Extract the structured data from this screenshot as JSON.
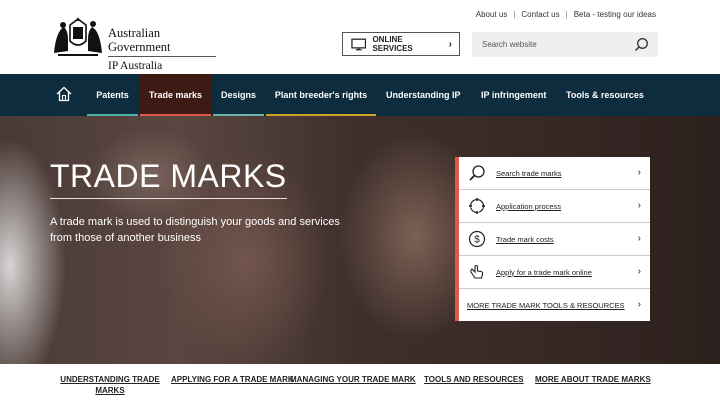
{
  "header": {
    "logo": {
      "line1": "Australian Government",
      "line2": "IP Australia"
    },
    "top_links": [
      "About us",
      "Contact us",
      "Beta - testing our ideas"
    ],
    "online_services": "ONLINE SERVICES",
    "search_placeholder": "Search website"
  },
  "nav": {
    "items": [
      {
        "label": "Patents",
        "bar_color": "#4fb3a7"
      },
      {
        "label": "Trade marks",
        "bar_color": "#e1584a",
        "active": true
      },
      {
        "label": "Designs",
        "bar_color": "#6cb6a9"
      },
      {
        "label": "Plant breeder's rights",
        "bar_color": "#c9a227"
      },
      {
        "label": "Understanding IP",
        "bar_color": ""
      },
      {
        "label": "IP infringement",
        "bar_color": ""
      },
      {
        "label": "Tools & resources",
        "bar_color": ""
      }
    ]
  },
  "hero": {
    "title": "TRADE MARKS",
    "subtitle": "A trade mark is used to distinguish your goods and services from those of another business"
  },
  "quick_links": [
    {
      "label": "Search trade marks",
      "icon": "magnifier-icon"
    },
    {
      "label": "Application process",
      "icon": "cycle-icon"
    },
    {
      "label": "Trade mark costs",
      "icon": "dollar-icon"
    },
    {
      "label": "Apply for a trade mark online",
      "icon": "pointer-hand-icon"
    },
    {
      "label": "MORE TRADE MARK TOOLS & RESOURCES",
      "icon": ""
    }
  ],
  "bottom_links": [
    "UNDERSTANDING TRADE MARKS",
    "APPLYING FOR A TRADE MARK",
    "MANAGING YOUR TRADE MARK",
    "TOOLS AND RESOURCES",
    "MORE ABOUT TRADE MARKS"
  ],
  "colors": {
    "nav_bg": "#0d2c3d",
    "accent": "#e1584a",
    "active_tab_bg": "#3d1a14"
  }
}
